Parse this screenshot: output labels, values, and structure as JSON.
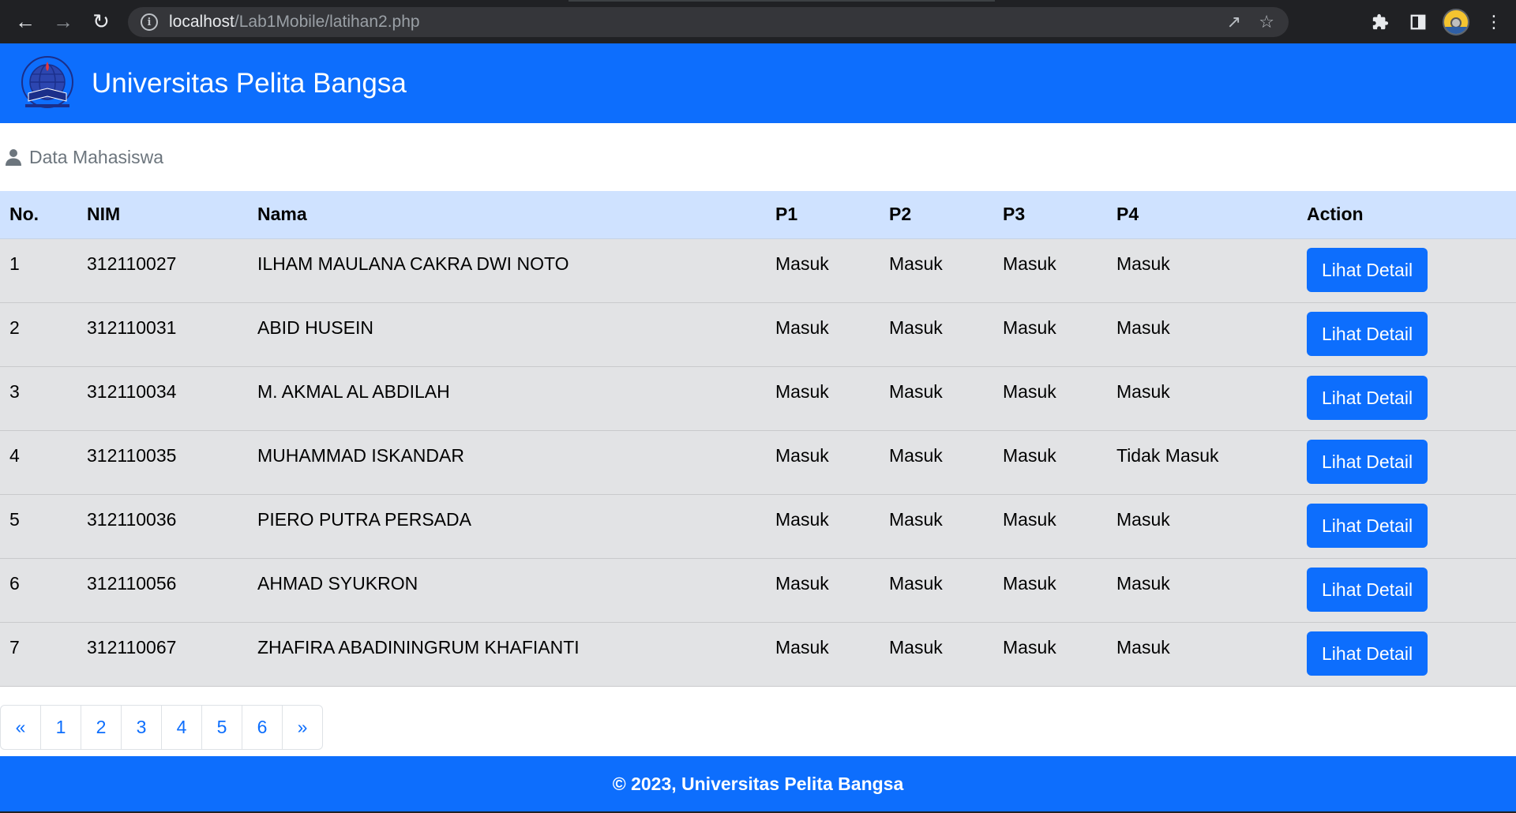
{
  "browser": {
    "url_host": "localhost",
    "url_path": "/Lab1Mobile/latihan2.php"
  },
  "site": {
    "title": "Universitas Pelita Bangsa",
    "brand_color": "#0d6efd"
  },
  "section": {
    "title": "Data Mahasiswa"
  },
  "table": {
    "headers": [
      "No.",
      "NIM",
      "Nama",
      "P1",
      "P2",
      "P3",
      "P4",
      "Action"
    ],
    "rows": [
      {
        "no": "1",
        "nim": "312110027",
        "nama": "ILHAM MAULANA CAKRA DWI NOTO",
        "p1": "Masuk",
        "p2": "Masuk",
        "p3": "Masuk",
        "p4": "Masuk",
        "action": "Lihat Detail"
      },
      {
        "no": "2",
        "nim": "312110031",
        "nama": "ABID HUSEIN",
        "p1": "Masuk",
        "p2": "Masuk",
        "p3": "Masuk",
        "p4": "Masuk",
        "action": "Lihat Detail"
      },
      {
        "no": "3",
        "nim": "312110034",
        "nama": "M. AKMAL AL ABDILAH",
        "p1": "Masuk",
        "p2": "Masuk",
        "p3": "Masuk",
        "p4": "Masuk",
        "action": "Lihat Detail"
      },
      {
        "no": "4",
        "nim": "312110035",
        "nama": "MUHAMMAD ISKANDAR",
        "p1": "Masuk",
        "p2": "Masuk",
        "p3": "Masuk",
        "p4": "Tidak Masuk",
        "action": "Lihat Detail"
      },
      {
        "no": "5",
        "nim": "312110036",
        "nama": "PIERO PUTRA PERSADA",
        "p1": "Masuk",
        "p2": "Masuk",
        "p3": "Masuk",
        "p4": "Masuk",
        "action": "Lihat Detail"
      },
      {
        "no": "6",
        "nim": "312110056",
        "nama": "AHMAD SYUKRON",
        "p1": "Masuk",
        "p2": "Masuk",
        "p3": "Masuk",
        "p4": "Masuk",
        "action": "Lihat Detail"
      },
      {
        "no": "7",
        "nim": "312110067",
        "nama": "ZHAFIRA ABADININGRUM KHAFIANTI",
        "p1": "Masuk",
        "p2": "Masuk",
        "p3": "Masuk",
        "p4": "Masuk",
        "action": "Lihat Detail"
      }
    ]
  },
  "pagination": {
    "prev": "«",
    "pages": [
      "1",
      "2",
      "3",
      "4",
      "5",
      "6"
    ],
    "next": "»"
  },
  "footer": {
    "text": "© 2023, Universitas Pelita Bangsa"
  }
}
